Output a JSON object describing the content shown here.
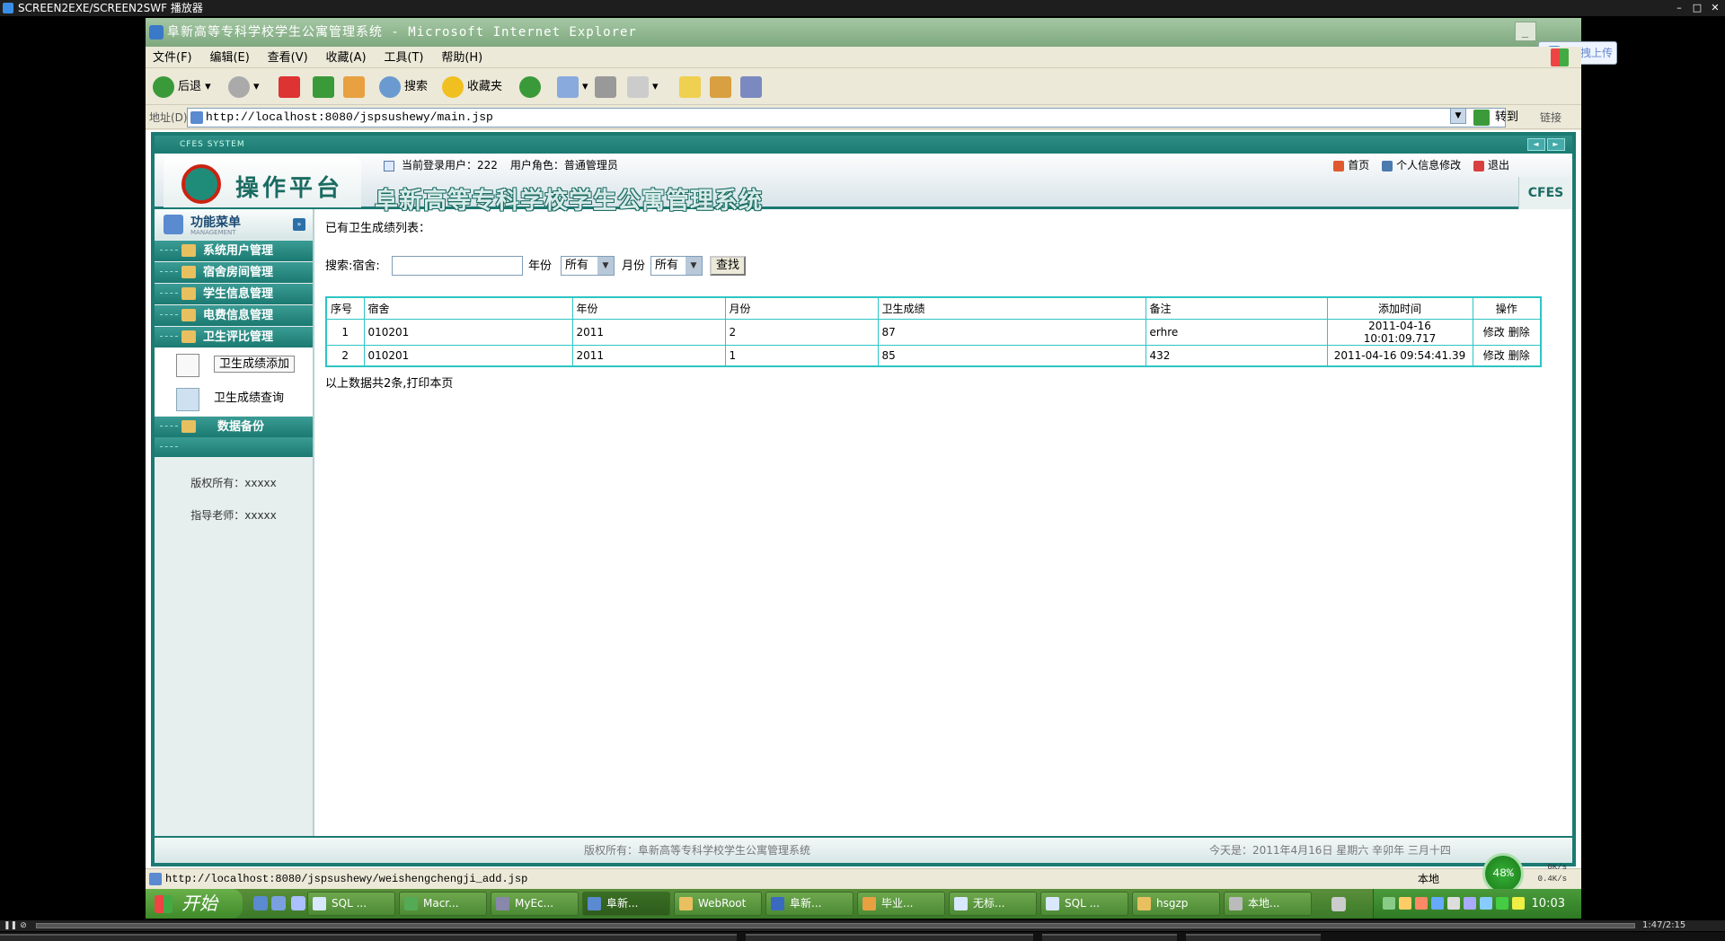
{
  "player": {
    "title": "SCREEN2EXE/SCREEN2SWF 播放器",
    "time": "1:47/2:15"
  },
  "ie": {
    "title": "阜新高等专科学校学生公寓管理系统 - Microsoft Internet Explorer",
    "menu": [
      "文件(F)",
      "编辑(E)",
      "查看(V)",
      "收藏(A)",
      "工具(T)",
      "帮助(H)"
    ],
    "toolbar": {
      "back": "后退",
      "search": "搜索",
      "favorites": "收藏夹"
    },
    "address_label": "地址(D)",
    "address": "http://localhost:8080/jspsushewy/main.jsp",
    "go": "转到",
    "links": "链接",
    "status_url": "http://localhost:8080/jspsushewy/weishengchengji_add.jsp",
    "status_zone": "本地",
    "upload_tip": "拖拽上传"
  },
  "speed": {
    "percent": "48%",
    "up": "0K/s",
    "down": "0.4K/s"
  },
  "app": {
    "top_strip": "CFES SYSTEM",
    "logo_text": "操作平台",
    "system_name": "阜新高等专科学校学生公寓管理系统",
    "current_user_label": "当前登录用户：222",
    "role_label": "用户角色：普通管理员",
    "links": {
      "home": "首页",
      "profile": "个人信息修改",
      "logout": "退出"
    },
    "badge": "CFES",
    "footer": "版权所有：阜新高等专科学校学生公寓管理系统",
    "date_line": "今天是：2011年4月16日 星期六 辛卯年 三月十四"
  },
  "sidebar": {
    "title": "功能菜单",
    "subtitle": "MANAGEMENT",
    "items": [
      "系统用户管理",
      "宿舍房间管理",
      "学生信息管理",
      "电费信息管理",
      "卫生评比管理"
    ],
    "sub_items": [
      "卫生成绩添加",
      "卫生成绩查询"
    ],
    "backup": "数据备份",
    "copyright": "版权所有：xxxxx",
    "teacher": "指导老师：xxxxx"
  },
  "main": {
    "list_title": "已有卫生成绩列表：",
    "search_label": "搜索:宿舍:",
    "year_label": "年份",
    "month_label": "月份",
    "year_value": "所有",
    "month_value": "所有",
    "find": "查找",
    "columns": [
      "序号",
      "宿舍",
      "年份",
      "月份",
      "卫生成绩",
      "备注",
      "添加时间",
      "操作"
    ],
    "rows": [
      {
        "no": "1",
        "dorm": "010201",
        "year": "2011",
        "month": "2",
        "score": "87",
        "note": "erhre",
        "time": "2011-04-16 10:01:09.717",
        "edit": "修改",
        "del": "删除"
      },
      {
        "no": "2",
        "dorm": "010201",
        "year": "2011",
        "month": "1",
        "score": "85",
        "note": "432",
        "time": "2011-04-16 09:54:41.39",
        "edit": "修改",
        "del": "删除"
      }
    ],
    "footer": "以上数据共2条,打印本页"
  },
  "taskbar": {
    "start": "开始",
    "tasks": [
      "SQL ...",
      "Macr...",
      "MyEc...",
      "阜新...",
      "WebRoot",
      "阜新...",
      "毕业...",
      "无标...",
      "SQL ...",
      "hsgzp",
      "本地..."
    ],
    "clock": "10:03"
  }
}
